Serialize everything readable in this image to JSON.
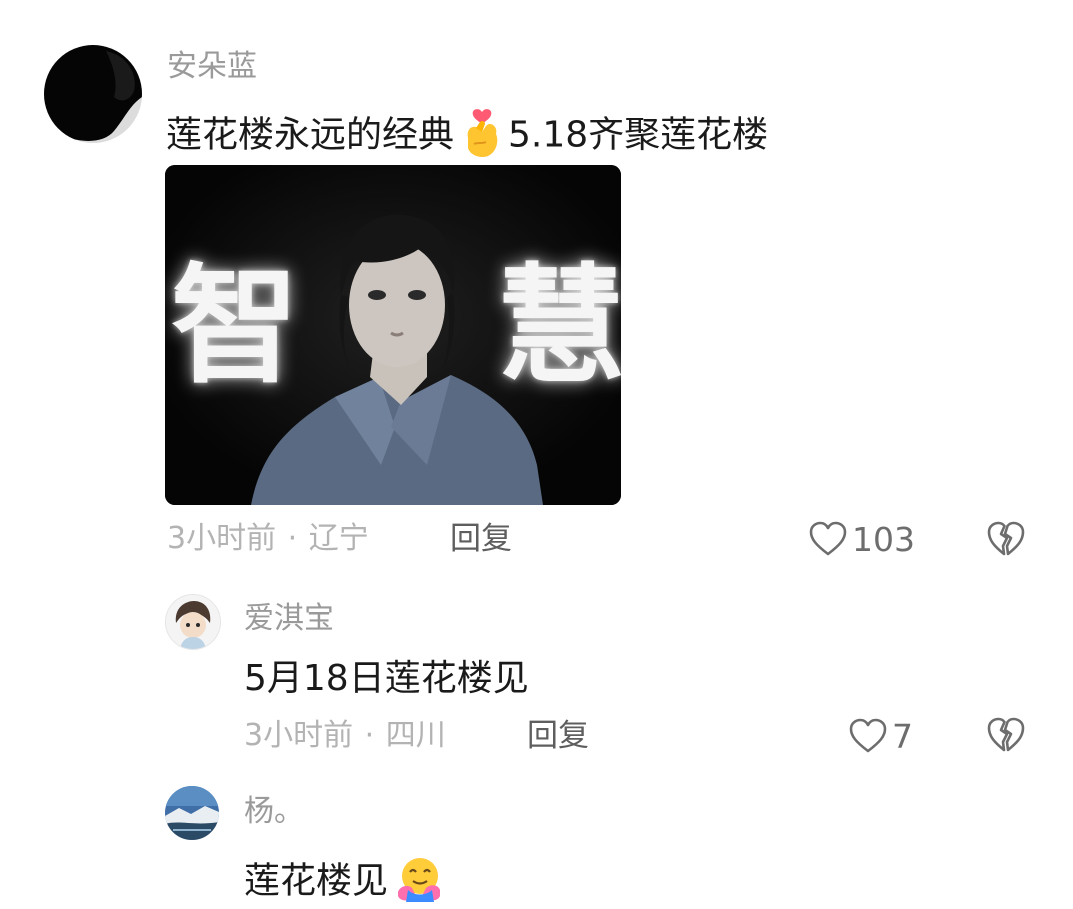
{
  "comment": {
    "username": "安朵蓝",
    "text_before_emoji": "莲花楼永远的经典",
    "text_after_emoji": "5.18齐聚莲花楼",
    "emoji": "finger-heart-emoji",
    "image": {
      "overlay_left": "智",
      "overlay_right": "慧"
    },
    "time": "3小时前",
    "location": "辽宁",
    "separator": "·",
    "reply_label": "回复",
    "like_count": "103",
    "icons": {
      "like": "heart-outline-icon",
      "dislike": "broken-heart-icon"
    }
  },
  "replies": [
    {
      "username": "爱淇宝",
      "text": "5月18日莲花楼见",
      "time": "3小时前",
      "location": "四川",
      "separator": "·",
      "reply_label": "回复",
      "like_count": "7"
    },
    {
      "username": "杨。",
      "text": "莲花楼见",
      "emoji": "hugging-face-emoji"
    }
  ],
  "colors": {
    "username": "#9a9a9a",
    "body_text": "#1a1a1a",
    "meta": "#b3b3b3",
    "reply": "#5e5e5e"
  }
}
